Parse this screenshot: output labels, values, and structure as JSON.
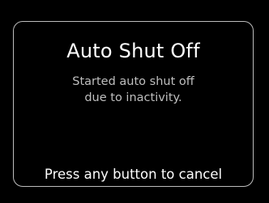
{
  "dialog": {
    "title": "Auto Shut Off",
    "message_lines": [
      "Started auto shut off",
      "due to inactivity."
    ],
    "footer_hint": "Press any button to cancel"
  },
  "colors": {
    "background": "#000000",
    "title": "#ffffff",
    "message": "#bfbfbf",
    "frame_border": "#bdbdbd"
  }
}
